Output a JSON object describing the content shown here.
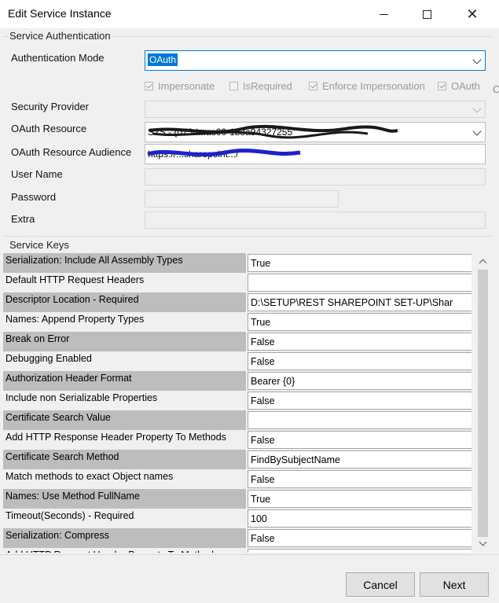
{
  "window": {
    "title": "Edit Service Instance",
    "minimize_icon": "minimize-icon",
    "maximize_icon": "maximize-icon",
    "close_icon": "close-icon"
  },
  "auth_group": {
    "label": "Service Authentication",
    "authentication_mode": {
      "label": "Authentication Mode",
      "value": "OAuth"
    },
    "checkboxes": [
      {
        "label": "Impersonate",
        "checked": true
      },
      {
        "label": "IsRequired",
        "checked": false
      },
      {
        "label": "Enforce Impersonation",
        "checked": true
      },
      {
        "label": "OAuth",
        "checked": true
      }
    ],
    "edge_char": "C",
    "security_provider": {
      "label": "Security Provider",
      "value": ""
    },
    "oauth_resource": {
      "label": "OAuth Resource",
      "value": "S2S - {073d...ac00-1b3a94327255"
    },
    "oauth_resource_audience": {
      "label": "OAuth Resource Audience",
      "value": "https://...sharepoint.../"
    },
    "user_name": {
      "label": "User Name",
      "value": ""
    },
    "password": {
      "label": "Password",
      "value": ""
    },
    "extra": {
      "label": "Extra",
      "value": ""
    }
  },
  "keys_group": {
    "label": "Service Keys",
    "rows": [
      {
        "key": "Serialization: Include All Assembly Types",
        "value": "True"
      },
      {
        "key": "Default HTTP Request Headers",
        "value": ""
      },
      {
        "key": "Descriptor Location - Required",
        "value": "D:\\SETUP\\REST SHAREPOINT SET-UP\\Shar"
      },
      {
        "key": "Names: Append Property Types",
        "value": "True"
      },
      {
        "key": "Break on Error",
        "value": "False"
      },
      {
        "key": "Debugging Enabled",
        "value": "False"
      },
      {
        "key": "Authorization Header Format",
        "value": "Bearer {0}"
      },
      {
        "key": "Include non Serializable Properties",
        "value": "False"
      },
      {
        "key": "Certificate Search Value",
        "value": ""
      },
      {
        "key": "Add HTTP Response Header Property To Methods",
        "value": "False"
      },
      {
        "key": "Certificate Search Method",
        "value": "FindBySubjectName"
      },
      {
        "key": "Match methods to exact Object names",
        "value": "False"
      },
      {
        "key": "Names: Use Method FullName",
        "value": "True"
      },
      {
        "key": "Timeout(Seconds) - Required",
        "value": "100"
      },
      {
        "key": "Serialization: Compress",
        "value": "False"
      },
      {
        "key": "Add HTTP Request Header Property To Methods",
        "value": ""
      }
    ]
  },
  "buttons": {
    "cancel": "Cancel",
    "next": "Next"
  },
  "colors": {
    "selection": "#0078d7",
    "alt_row": "#bdbdbd",
    "scribble": "#1a1a1a",
    "scribble_blue": "#1e22c8"
  }
}
